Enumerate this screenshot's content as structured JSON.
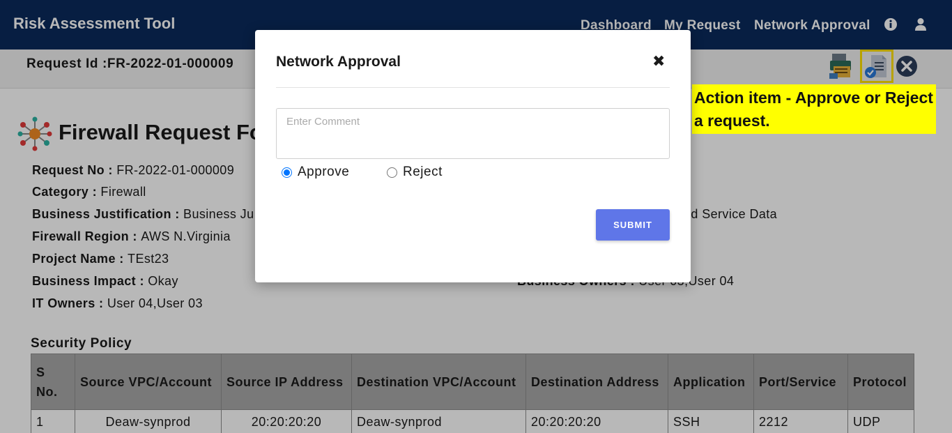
{
  "navbar": {
    "brand": "Risk Assessment Tool",
    "links": [
      "Dashboard",
      "My Request",
      "Network Approval"
    ],
    "icons": [
      "info-circle-icon",
      "user-icon"
    ]
  },
  "subbar": {
    "request_id": "Request Id :FR-2022-01-000009"
  },
  "page": {
    "title": "Firewall Request Fo",
    "fields": [
      {
        "label": "Request No : ",
        "value": "FR-2022-01-000009"
      },
      {
        "label": "Category : ",
        "value": "Firewall"
      },
      {
        "label": "Business Justification : ",
        "value": "Business Ju"
      },
      {
        "label": "Firewall Region : ",
        "value": "AWS N.Virginia"
      },
      {
        "label": "Project Name : ",
        "value": "TEst23"
      },
      {
        "label": "Business Impact : ",
        "value": "Okay"
      },
      {
        "label": "IT Owners : ",
        "value": "User 04,User 03"
      }
    ],
    "right_fields": {
      "data_fragment": "ed Service Data",
      "business_owners_label": "Business Owners : ",
      "business_owners_value": "User 03,User 04"
    },
    "security_policy_title": "Security Policy",
    "table": {
      "headers": [
        "S No.",
        "Source VPC/Account",
        "Source IP Address",
        "Destination VPC/Account",
        "Destination Address",
        "Application",
        "Port/Service",
        "Protocol"
      ],
      "rows": [
        [
          "1",
          "Deaw-synprod",
          "20:20:20:20",
          "Deaw-synprod",
          "20:20:20:20",
          "SSH",
          "2212",
          "UDP"
        ]
      ]
    }
  },
  "callout": {
    "text": "Action item - Approve or Reject a request.",
    "color": "#ffff00"
  },
  "modal": {
    "title": "Network Approval",
    "close_glyph": "✖",
    "comment_placeholder": "Enter Comment",
    "comment_value": "",
    "options": [
      {
        "label": "Approve",
        "checked": true
      },
      {
        "label": "Reject",
        "checked": false
      }
    ],
    "submit_label": "SUBMIT",
    "accent": "#5f76e8"
  },
  "colors": {
    "navbar": "#0b2a5c",
    "highlight": "#ffe100"
  }
}
